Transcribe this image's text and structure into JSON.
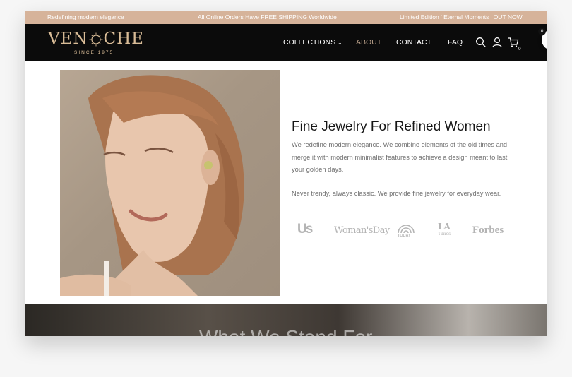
{
  "announcement": {
    "left": "Redefining modern elegance",
    "center": "All Online Orders Have FREE SHIPPING Worldwide",
    "right": "Limited Edition ' Eternal Moments ' OUT NOW"
  },
  "brand": {
    "name_left": "VEN",
    "name_right": "CHE",
    "tagline": "SINCE 1975"
  },
  "nav": {
    "collections": "COLLECTIONS",
    "about": "ABOUT",
    "contact": "CONTACT",
    "faq": "FAQ",
    "cart_count": "0"
  },
  "floating_cart": {
    "count": "0"
  },
  "intro": {
    "headline": "Fine Jewelry For Refined Women",
    "paragraph1": "We redefine modern elegance. We combine elements of the old times and merge it with modern minimalist features to achieve a design meant to last your golden days.",
    "paragraph2": "Never trendy, always classic. We provide fine jewelry for everyday wear."
  },
  "press": {
    "us": "Us",
    "womansday": "Woman'sDay",
    "today": "TODAY",
    "la_top": "LA",
    "la_bottom": "Times",
    "forbes": "Forbes"
  },
  "section2": {
    "title": "What We Stand For"
  },
  "colors": {
    "topbar": "#d6b39a",
    "nav": "#0b0b0b",
    "gold": "#d9bc97",
    "accent": "#e8864f"
  }
}
